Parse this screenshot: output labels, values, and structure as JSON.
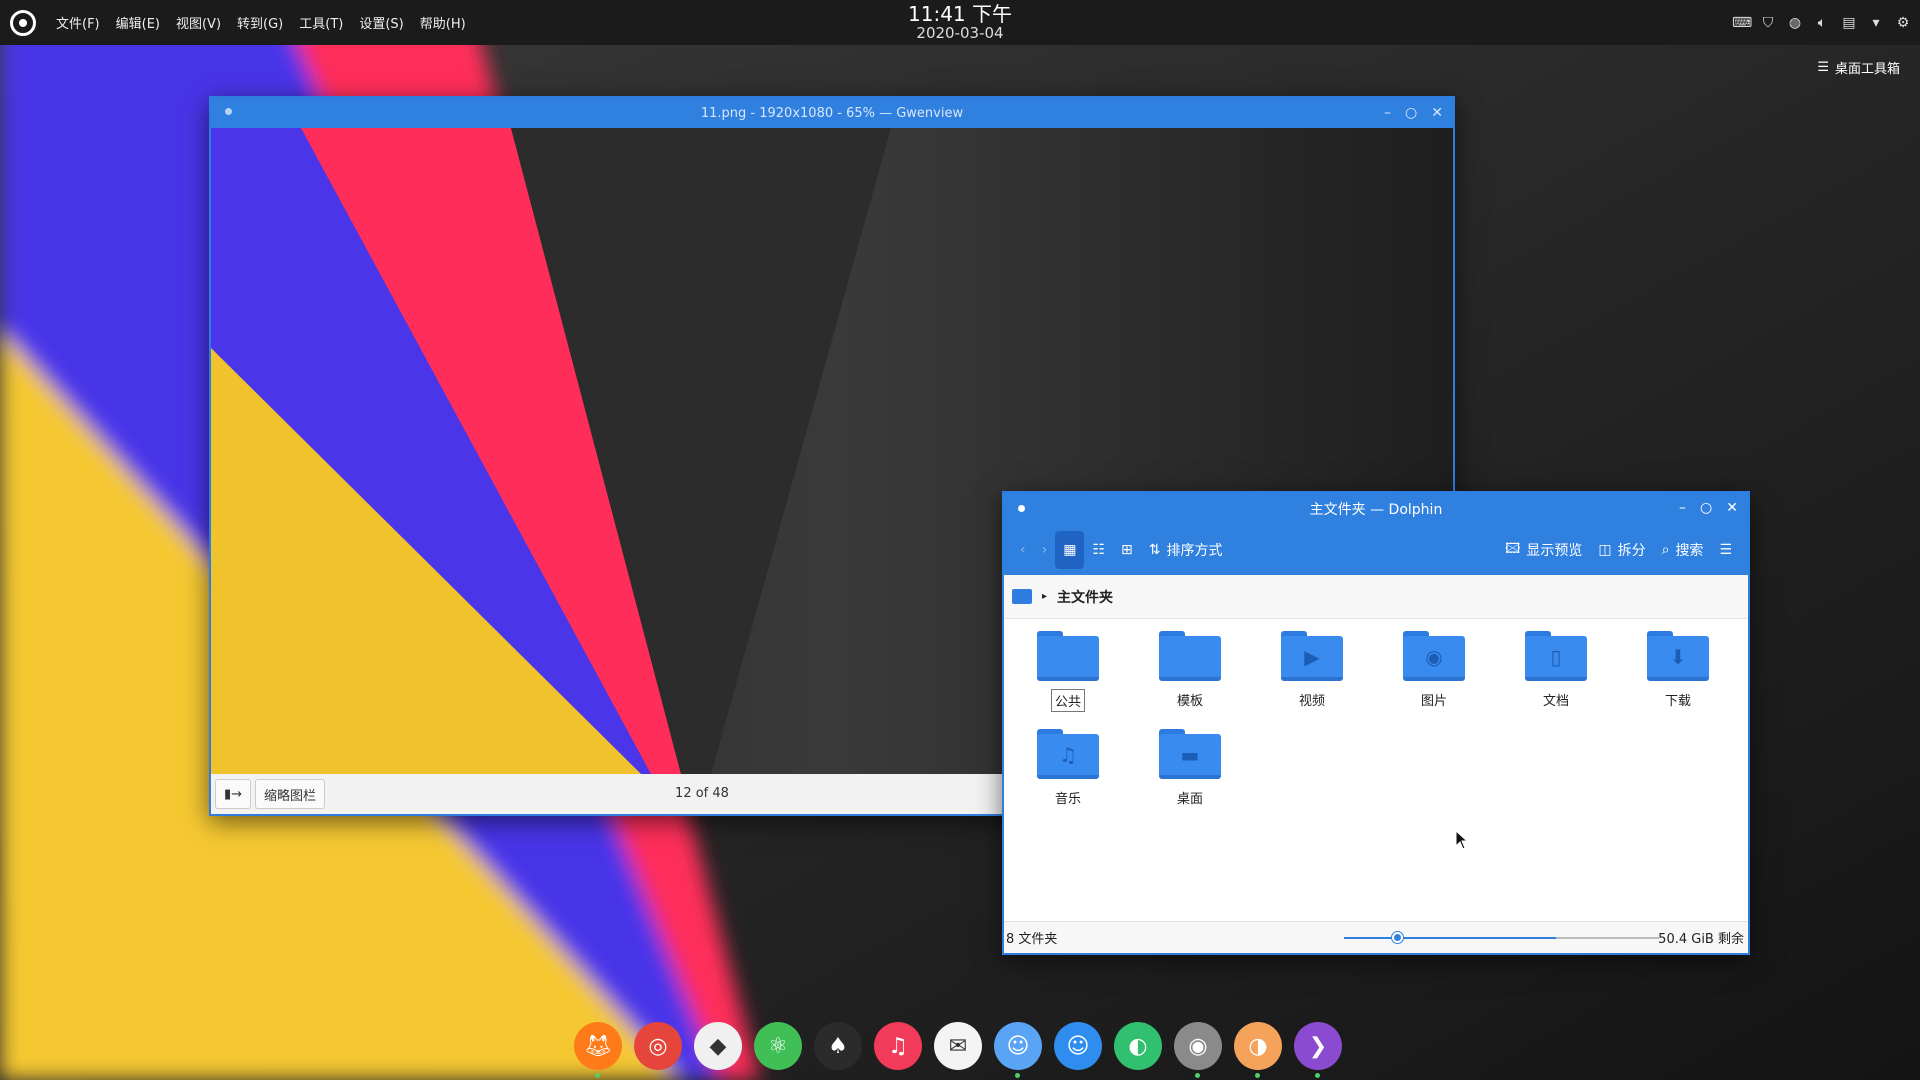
{
  "top_panel": {
    "menu": [
      "文件(F)",
      "编辑(E)",
      "视图(V)",
      "转到(G)",
      "工具(T)",
      "设置(S)",
      "帮助(H)"
    ],
    "clock_time": "11:41 下午",
    "clock_date": "2020-03-04",
    "tray_icons": [
      "keyboard-icon",
      "shield-icon",
      "network-icon",
      "volume-icon",
      "clipboard-icon",
      "expand-arrow-icon",
      "settings-icon"
    ]
  },
  "desktop": {
    "toolbox_label": "桌面工具箱",
    "wallpaper_colors": [
      "#4a36e8",
      "#ff2d5a",
      "#f7d230",
      "#2a2a2a"
    ]
  },
  "gwenview": {
    "title": "11.png - 1920x1080 - 65% — Gwenview",
    "thumbnail_bar_button": "缩略图栏",
    "image_counter": "12 of 48"
  },
  "dolphin": {
    "title": "主文件夹 — Dolphin",
    "toolbar": {
      "sort_label": "排序方式",
      "preview_label": "显示预览",
      "split_label": "拆分",
      "search_label": "搜索"
    },
    "location": "主文件夹",
    "folders": [
      {
        "name": "公共",
        "glyph": ""
      },
      {
        "name": "模板",
        "glyph": ""
      },
      {
        "name": "视频",
        "glyph": "▶"
      },
      {
        "name": "图片",
        "glyph": "◉"
      },
      {
        "name": "文档",
        "glyph": "▯"
      },
      {
        "name": "下载",
        "glyph": "⬇"
      },
      {
        "name": "音乐",
        "glyph": "♫"
      },
      {
        "name": "桌面",
        "glyph": "▬"
      }
    ],
    "status": {
      "count": "8 文件夹",
      "free_space": "50.4 GiB 剩余",
      "zoom_level": 0.27,
      "disk_used_fraction": 0.1
    }
  },
  "dock": {
    "apps": [
      {
        "name": "firefox",
        "color": "#ff7a18"
      },
      {
        "name": "chrome",
        "color": "#e5453a"
      },
      {
        "name": "github",
        "color": "#f0f0f0"
      },
      {
        "name": "atom",
        "color": "#3fbf55"
      },
      {
        "name": "inkscape",
        "color": "#2b2b2b"
      },
      {
        "name": "music",
        "color": "#f23a5a"
      },
      {
        "name": "mail",
        "color": "#f4f4f4"
      },
      {
        "name": "finder",
        "color": "#5aa4f5"
      },
      {
        "name": "finder-2",
        "color": "#2f8df0"
      },
      {
        "name": "colors",
        "color": "#30c070"
      },
      {
        "name": "disk-utility",
        "color": "#8a8a8a"
      },
      {
        "name": "photos",
        "color": "#f5a35a"
      },
      {
        "name": "visual-studio",
        "color": "#8a4bd0"
      }
    ]
  }
}
